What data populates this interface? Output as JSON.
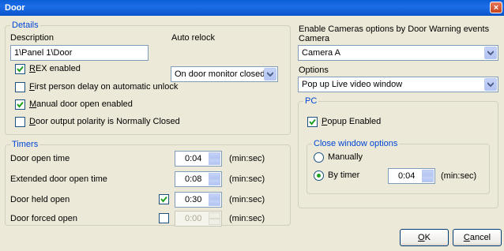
{
  "window": {
    "title": "Door",
    "close_glyph": "×"
  },
  "details": {
    "legend": "Details",
    "description_label": "Description",
    "description_value": "1\\Panel 1\\Door",
    "auto_relock_label": "Auto relock",
    "auto_relock_value": "On door monitor closed",
    "checkboxes": [
      {
        "label_u": "R",
        "label_rest": "EX enabled",
        "checked": true
      },
      {
        "label_u": "F",
        "label_rest": "irst person delay on automatic unlock",
        "checked": false
      },
      {
        "label_u": "M",
        "label_rest": "anual door open enabled",
        "checked": true
      },
      {
        "label_u": "D",
        "label_rest": "oor output polarity is Normally Closed",
        "checked": false
      }
    ]
  },
  "timers": {
    "legend": "Timers",
    "rows": [
      {
        "label": "Door open time",
        "value": "0:04",
        "unit": "(min:sec)",
        "has_checkbox": false
      },
      {
        "label": "Extended  door open time",
        "value": "0:08",
        "unit": "(min:sec)",
        "has_checkbox": false
      },
      {
        "label": "Door held open",
        "value": "0:30",
        "unit": "(min:sec)",
        "has_checkbox": true,
        "checked": true
      },
      {
        "label": "Door forced open",
        "value": "0:00",
        "unit": "(min:sec)",
        "has_checkbox": true,
        "checked": false,
        "disabled": true
      }
    ]
  },
  "cameras": {
    "legend": "Enable Cameras options by Door Warning events",
    "camera_label": "Camera",
    "camera_value": "Camera A",
    "options_label": "Options",
    "options_value": "Pop up Live video window",
    "pc": {
      "legend": "PC",
      "popup_u": "P",
      "popup_rest": "opup Enabled",
      "close_window": {
        "legend": "Close window options",
        "manually_label": "Manually",
        "by_timer_label": "By timer",
        "timer_value": "0:04",
        "timer_unit": "(min:sec)"
      }
    }
  },
  "buttons": {
    "ok_u": "O",
    "ok_rest": "K",
    "cancel_u": "C",
    "cancel_rest": "ancel"
  },
  "colors": {
    "legend": "#0046d5",
    "title_bar": "#0a5fd6",
    "check": "#21a121"
  }
}
